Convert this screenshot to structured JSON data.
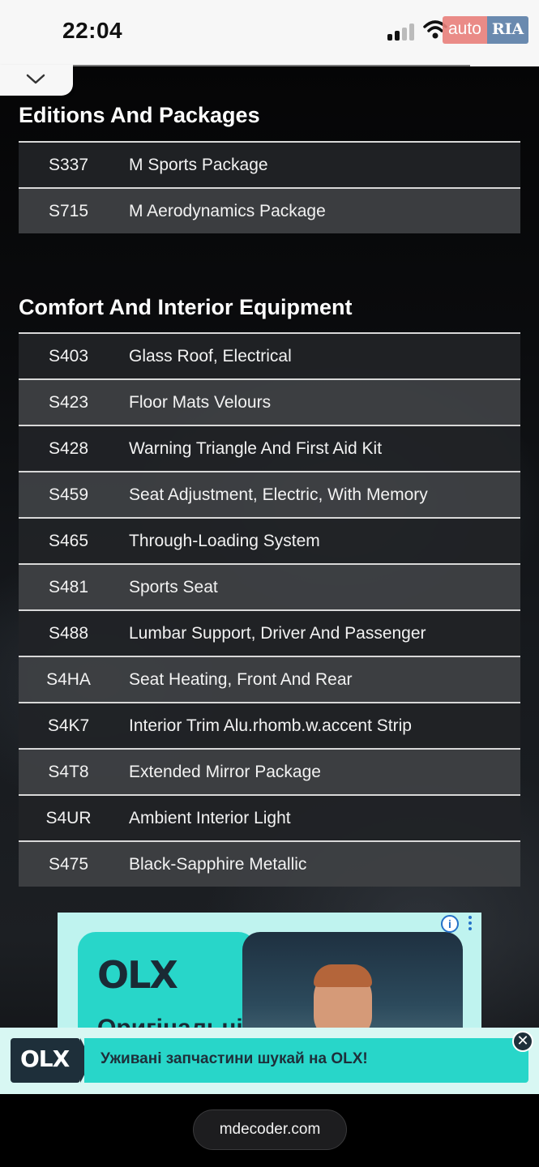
{
  "status_bar": {
    "time": "22:04",
    "signal_icon": "cellular-signal-icon",
    "wifi_icon": "wifi-icon",
    "badge_left": "auto",
    "badge_right": "RIA"
  },
  "collapse_icon": "chevron-down-icon",
  "sections": [
    {
      "title": "Editions And Packages",
      "rows": [
        {
          "code": "S337",
          "desc": "M Sports Package"
        },
        {
          "code": "S715",
          "desc": "M Aerodynamics Package"
        }
      ]
    },
    {
      "title": "Comfort And Interior Equipment",
      "rows": [
        {
          "code": "S403",
          "desc": "Glass Roof, Electrical"
        },
        {
          "code": "S423",
          "desc": "Floor Mats Velours"
        },
        {
          "code": "S428",
          "desc": "Warning Triangle And First Aid Kit"
        },
        {
          "code": "S459",
          "desc": "Seat Adjustment, Electric, With Memory"
        },
        {
          "code": "S465",
          "desc": "Through-Loading System"
        },
        {
          "code": "S481",
          "desc": "Sports Seat"
        },
        {
          "code": "S488",
          "desc": "Lumbar Support, Driver And Passenger"
        },
        {
          "code": "S4HA",
          "desc": "Seat Heating, Front And Rear"
        },
        {
          "code": "S4K7",
          "desc": "Interior Trim Alu.rhomb.w.accent Strip"
        },
        {
          "code": "S4T8",
          "desc": "Extended Mirror Package"
        },
        {
          "code": "S4UR",
          "desc": "Ambient Interior Light"
        },
        {
          "code": "S475",
          "desc": "Black-Sapphire Metallic"
        }
      ]
    }
  ],
  "ad": {
    "logo": "OLX",
    "headline_partial": "Оригінальні",
    "info_icon": "info-icon",
    "more_icon": "more-vertical-icon"
  },
  "banner": {
    "logo": "OLX",
    "text": "Уживані запчастини шукай на OLX!",
    "close_icon": "close-icon"
  },
  "browser": {
    "url": "mdecoder.com"
  }
}
